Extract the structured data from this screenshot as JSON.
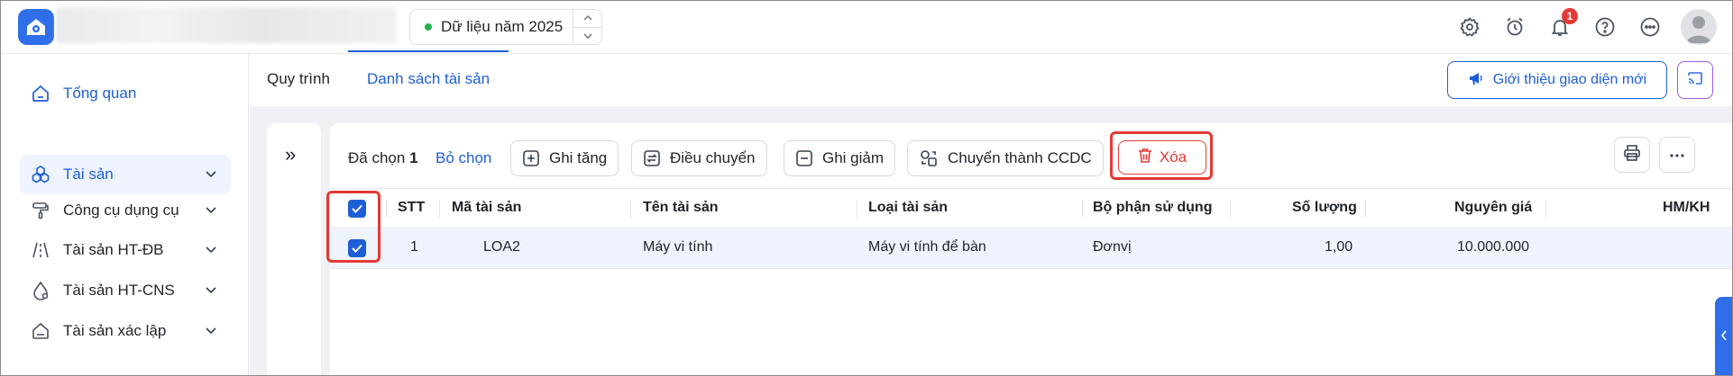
{
  "header": {
    "year_selector": "Dữ liệu năm 2025",
    "notifications_count": "1"
  },
  "sidebar": {
    "items": [
      {
        "label": "Tổng quan"
      },
      {
        "label": "Tài sản"
      },
      {
        "label": "Công cụ dụng cụ"
      },
      {
        "label": "Tài sản HT-ĐB"
      },
      {
        "label": "Tài sản HT-CNS"
      },
      {
        "label": "Tài sản xác lập"
      }
    ]
  },
  "tabs": [
    {
      "label": "Quy trình"
    },
    {
      "label": "Danh sách tài sản"
    }
  ],
  "intro_button": "Giới thiệu giao diện mới",
  "toolbar": {
    "selected_prefix": "Đã chọn",
    "selected_count": "1",
    "deselect": "Bỏ chọn",
    "increase": "Ghi tăng",
    "transfer": "Điều chuyển",
    "decrease": "Ghi giảm",
    "convert": "Chuyển thành CCDC",
    "delete": "Xóa"
  },
  "table": {
    "columns": [
      "STT",
      "Mã tài sản",
      "Tên tài sản",
      "Loại tài sản",
      "Bộ phận sử dụng",
      "Số lượng",
      "Nguyên giá",
      "HM/KH"
    ],
    "rows": [
      {
        "stt": "1",
        "code": "LOA2",
        "name": "Máy vi tính",
        "type": "Máy vi tính để bàn",
        "dept": "Đơnvị",
        "qty": "1,00",
        "cost": "10.000.000"
      }
    ]
  },
  "colors": {
    "primary": "#1e5fd6",
    "danger": "#e53935",
    "selected_row": "#eef3fd"
  }
}
